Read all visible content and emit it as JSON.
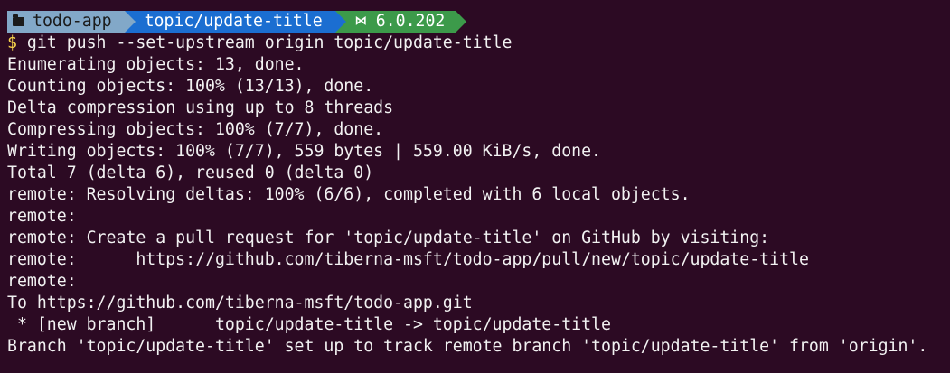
{
  "prompt": {
    "directory": "todo-app",
    "branch": "topic/update-title",
    "dotnet_version": "6.0.202",
    "folder_icon": "folder-icon",
    "dotnet_icon": "dotnet-icon",
    "colors": {
      "background": "#2c0a23",
      "directory_segment": "#82a8c8",
      "branch_segment": "#1b6ed1",
      "dotnet_segment": "#3c9a4a",
      "prompt_symbol": "#f6d34c",
      "text": "#f2f2f2"
    }
  },
  "command": {
    "symbol": "$",
    "text": " git push --set-upstream origin topic/update-title"
  },
  "output": [
    "Enumerating objects: 13, done.",
    "Counting objects: 100% (13/13), done.",
    "Delta compression using up to 8 threads",
    "Compressing objects: 100% (7/7), done.",
    "Writing objects: 100% (7/7), 559 bytes | 559.00 KiB/s, done.",
    "Total 7 (delta 6), reused 0 (delta 0)",
    "remote: Resolving deltas: 100% (6/6), completed with 6 local objects.",
    "remote:",
    "remote: Create a pull request for 'topic/update-title' on GitHub by visiting:",
    "remote:      https://github.com/tiberna-msft/todo-app/pull/new/topic/update-title",
    "remote:",
    "To https://github.com/tiberna-msft/todo-app.git",
    " * [new branch]      topic/update-title -> topic/update-title",
    "Branch 'topic/update-title' set up to track remote branch 'topic/update-title' from 'origin'."
  ]
}
